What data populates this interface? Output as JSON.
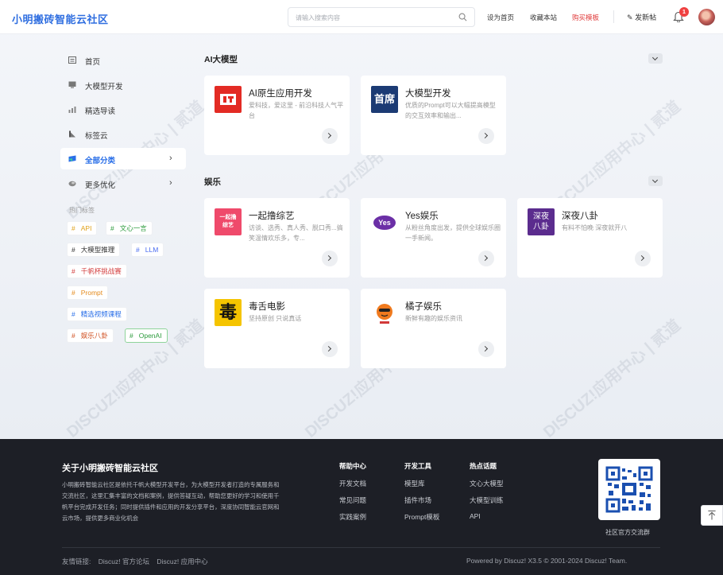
{
  "header": {
    "logo": "小明搬砖智能云社区",
    "search_placeholder": "请输入搜索内容",
    "links": [
      "设为首页",
      "收藏本站",
      "购买模板"
    ],
    "post_label": "发新帖",
    "notification_count": "1"
  },
  "sidebar": {
    "items": [
      {
        "label": "首页",
        "icon": "home-icon"
      },
      {
        "label": "大模型开发",
        "icon": "monitor-icon"
      },
      {
        "label": "精选导读",
        "icon": "chart-icon"
      },
      {
        "label": "标签云",
        "icon": "tag-icon"
      },
      {
        "label": "全部分类",
        "icon": "category-icon",
        "active": true
      },
      {
        "label": "更多优化",
        "icon": "more-icon"
      }
    ],
    "hot_tags_title": "热门标签",
    "tags": [
      {
        "label": "API",
        "color": "#e0a21b"
      },
      {
        "label": "文心一言",
        "color": "#2c9b3c"
      },
      {
        "label": "大模型推理",
        "color": "#333333"
      },
      {
        "label": "LLM",
        "color": "#4a6cf0"
      },
      {
        "label": "千帆杯挑战赛",
        "color": "#d23a3a"
      },
      {
        "label": "Prompt",
        "color": "#e48a1c"
      },
      {
        "label": "精选视频课程",
        "color": "#2a6fe8"
      },
      {
        "label": "娱乐八卦",
        "color": "#d04f20"
      },
      {
        "label": "OpenAI",
        "color": "#2c9b3c"
      }
    ]
  },
  "sections": [
    {
      "title": "AI大模型",
      "cards": [
        {
          "title": "AI原生应用开发",
          "desc": "爱科技，爱这里 - 前沿科技人气平台",
          "icon_text": "IT",
          "icon_color": "#e32b24"
        },
        {
          "title": "大模型开发",
          "desc": "优质的Prompt可以大幅提高模型的交互效率和输出...",
          "icon_text": "首席",
          "icon_color": "#1c3b74"
        }
      ]
    },
    {
      "title": "娱乐",
      "cards": [
        {
          "title": "一起撸综艺",
          "desc": "访谈、选秀、真人秀、脱口秀...搞笑温情欢乐多，专...",
          "icon_text": "一起撸 综艺",
          "icon_color": "#ef4a6b"
        },
        {
          "title": "Yes娱乐",
          "desc": "从粉丝角度出发，提供全球娱乐圈一手新闻。",
          "icon_text": "Yes",
          "icon_color": "#6b2fa6"
        },
        {
          "title": "深夜八卦",
          "desc": "有料不怕晚 深夜就开八",
          "icon_text": "深夜 八卦",
          "icon_color": "#5b2c8e"
        },
        {
          "title": "毒舌电影",
          "desc": "坚持原创 只说真话",
          "icon_text": "毒",
          "icon_color": "#f5c400"
        },
        {
          "title": "橘子娱乐",
          "desc": "新鲜有趣的娱乐资讯",
          "icon_text": "橘子",
          "icon_color": "#f07a1e"
        }
      ]
    }
  ],
  "footer": {
    "about_title": "关于小明搬砖智能云社区",
    "about_text": "小明搬砖智能云社区是依托千帆大模型开发平台，为大模型开发者打造的专属服务和交流社区，这里汇集丰富的文档和案例，提供答疑互动，帮助您更好的学习和使用千帆平台完成开发任务；同时提供插件和应用的开发分享平台，深度协同智能云官网和云市场，提供更多商业化机会",
    "columns": [
      {
        "title": "帮助中心",
        "links": [
          "开发文档",
          "常见问题",
          "实践案例"
        ]
      },
      {
        "title": "开发工具",
        "links": [
          "模型库",
          "插件市场",
          "Prompt模板"
        ]
      },
      {
        "title": "热点话题",
        "links": [
          "文心大模型",
          "大模型训练",
          "API"
        ]
      }
    ],
    "qr_label": "社区官方交流群",
    "friends_label": "友情链接:",
    "friends": [
      "Discuz! 官方论坛",
      "Discuz! 应用中心"
    ],
    "powered": "Powered by  Discuz! X3.5  © 2001-2024  Discuz! Team."
  },
  "watermark": "DISCUZ!应用中心 | 贰道 addon.dismall.com"
}
